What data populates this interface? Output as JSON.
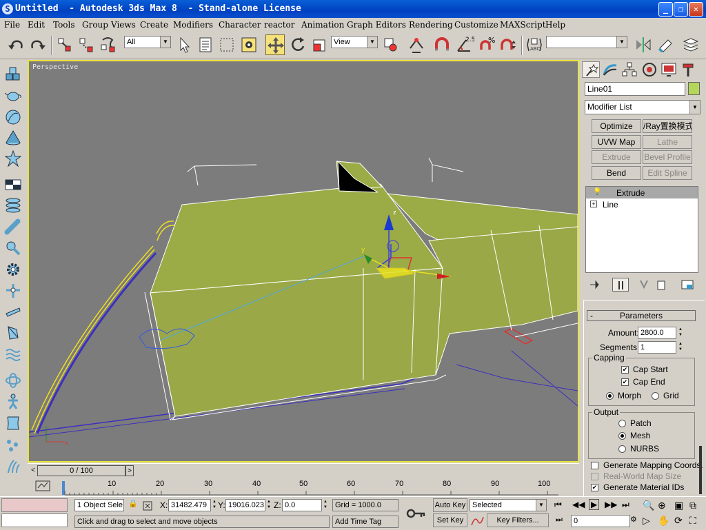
{
  "window": {
    "title": "Untitled  - Autodesk 3ds Max 8  - Stand-alone License",
    "app_icon": "S",
    "minimize_glyph": "_",
    "maximize_glyph": "❐",
    "close_glyph": "✕"
  },
  "menu": [
    "File",
    "Edit",
    "Tools",
    "Group",
    "Views",
    "Create",
    "Modifiers",
    "Character",
    "reactor",
    "Animation",
    "Graph Editors",
    "Rendering",
    "Customize",
    "MAXScript",
    "Help"
  ],
  "toolbar": {
    "selection_filter": "All",
    "reference_coord": "View",
    "snap_angle_label": "2.5",
    "percent_snap_label": "%",
    "named_selection": ""
  },
  "viewport": {
    "label": "Perspective",
    "gizmo": {
      "z": "z",
      "y": "y",
      "x": "x"
    }
  },
  "timeslider": {
    "position": "0 / 100",
    "left_arrow": "<",
    "right_arrow": ">",
    "ticks": [
      "10",
      "20",
      "30",
      "40",
      "50",
      "60",
      "70",
      "80",
      "90",
      "100"
    ]
  },
  "status": {
    "selection_count": "1 Object Sele",
    "x_label": "X:",
    "x_value": "31482.479",
    "y_label": "Y:",
    "y_value": "19016.023",
    "z_label": "Z:",
    "z_value": "0.0",
    "grid": "Grid = 1000.0",
    "prompt": "Click and drag to select and move objects",
    "add_time_tag": "Add Time Tag",
    "auto_key": "Auto Key",
    "set_key": "Set Key",
    "key_mode": "Selected",
    "key_filters": "Key Filters...",
    "current_frame": "0"
  },
  "panel": {
    "object_name": "Line01",
    "object_color": "#b6d65a",
    "modifier_list": "Modifier List",
    "buttons": [
      {
        "label": "Optimize",
        "enabled": true
      },
      {
        "label": "/Ray置换模式",
        "enabled": true
      },
      {
        "label": "UVW Map",
        "enabled": true
      },
      {
        "label": "Lathe",
        "enabled": false
      },
      {
        "label": "Extrude",
        "enabled": false
      },
      {
        "label": "Bevel Profile",
        "enabled": false
      },
      {
        "label": "Bend",
        "enabled": true
      },
      {
        "label": "Edit Spline",
        "enabled": false
      }
    ],
    "stack": [
      {
        "label": "Extrude",
        "selected": true
      },
      {
        "label": "Line",
        "selected": false
      }
    ],
    "expand_glyph": "+",
    "collapse_glyph": "-",
    "checked_glyph": "✔",
    "parameters": {
      "title": "Parameters",
      "amount_label": "Amount:",
      "amount_value": "2800.0",
      "segments_label": "Segments:",
      "segments_value": "1",
      "capping_title": "Capping",
      "cap_start": "Cap Start",
      "cap_end": "Cap End",
      "morph": "Morph",
      "grid": "Grid",
      "output_title": "Output",
      "patch": "Patch",
      "mesh": "Mesh",
      "nurbs": "NURBS",
      "gen_mapping": "Generate Mapping Coords.",
      "real_world": "Real-World Map Size",
      "gen_material": "Generate Material IDs"
    }
  }
}
